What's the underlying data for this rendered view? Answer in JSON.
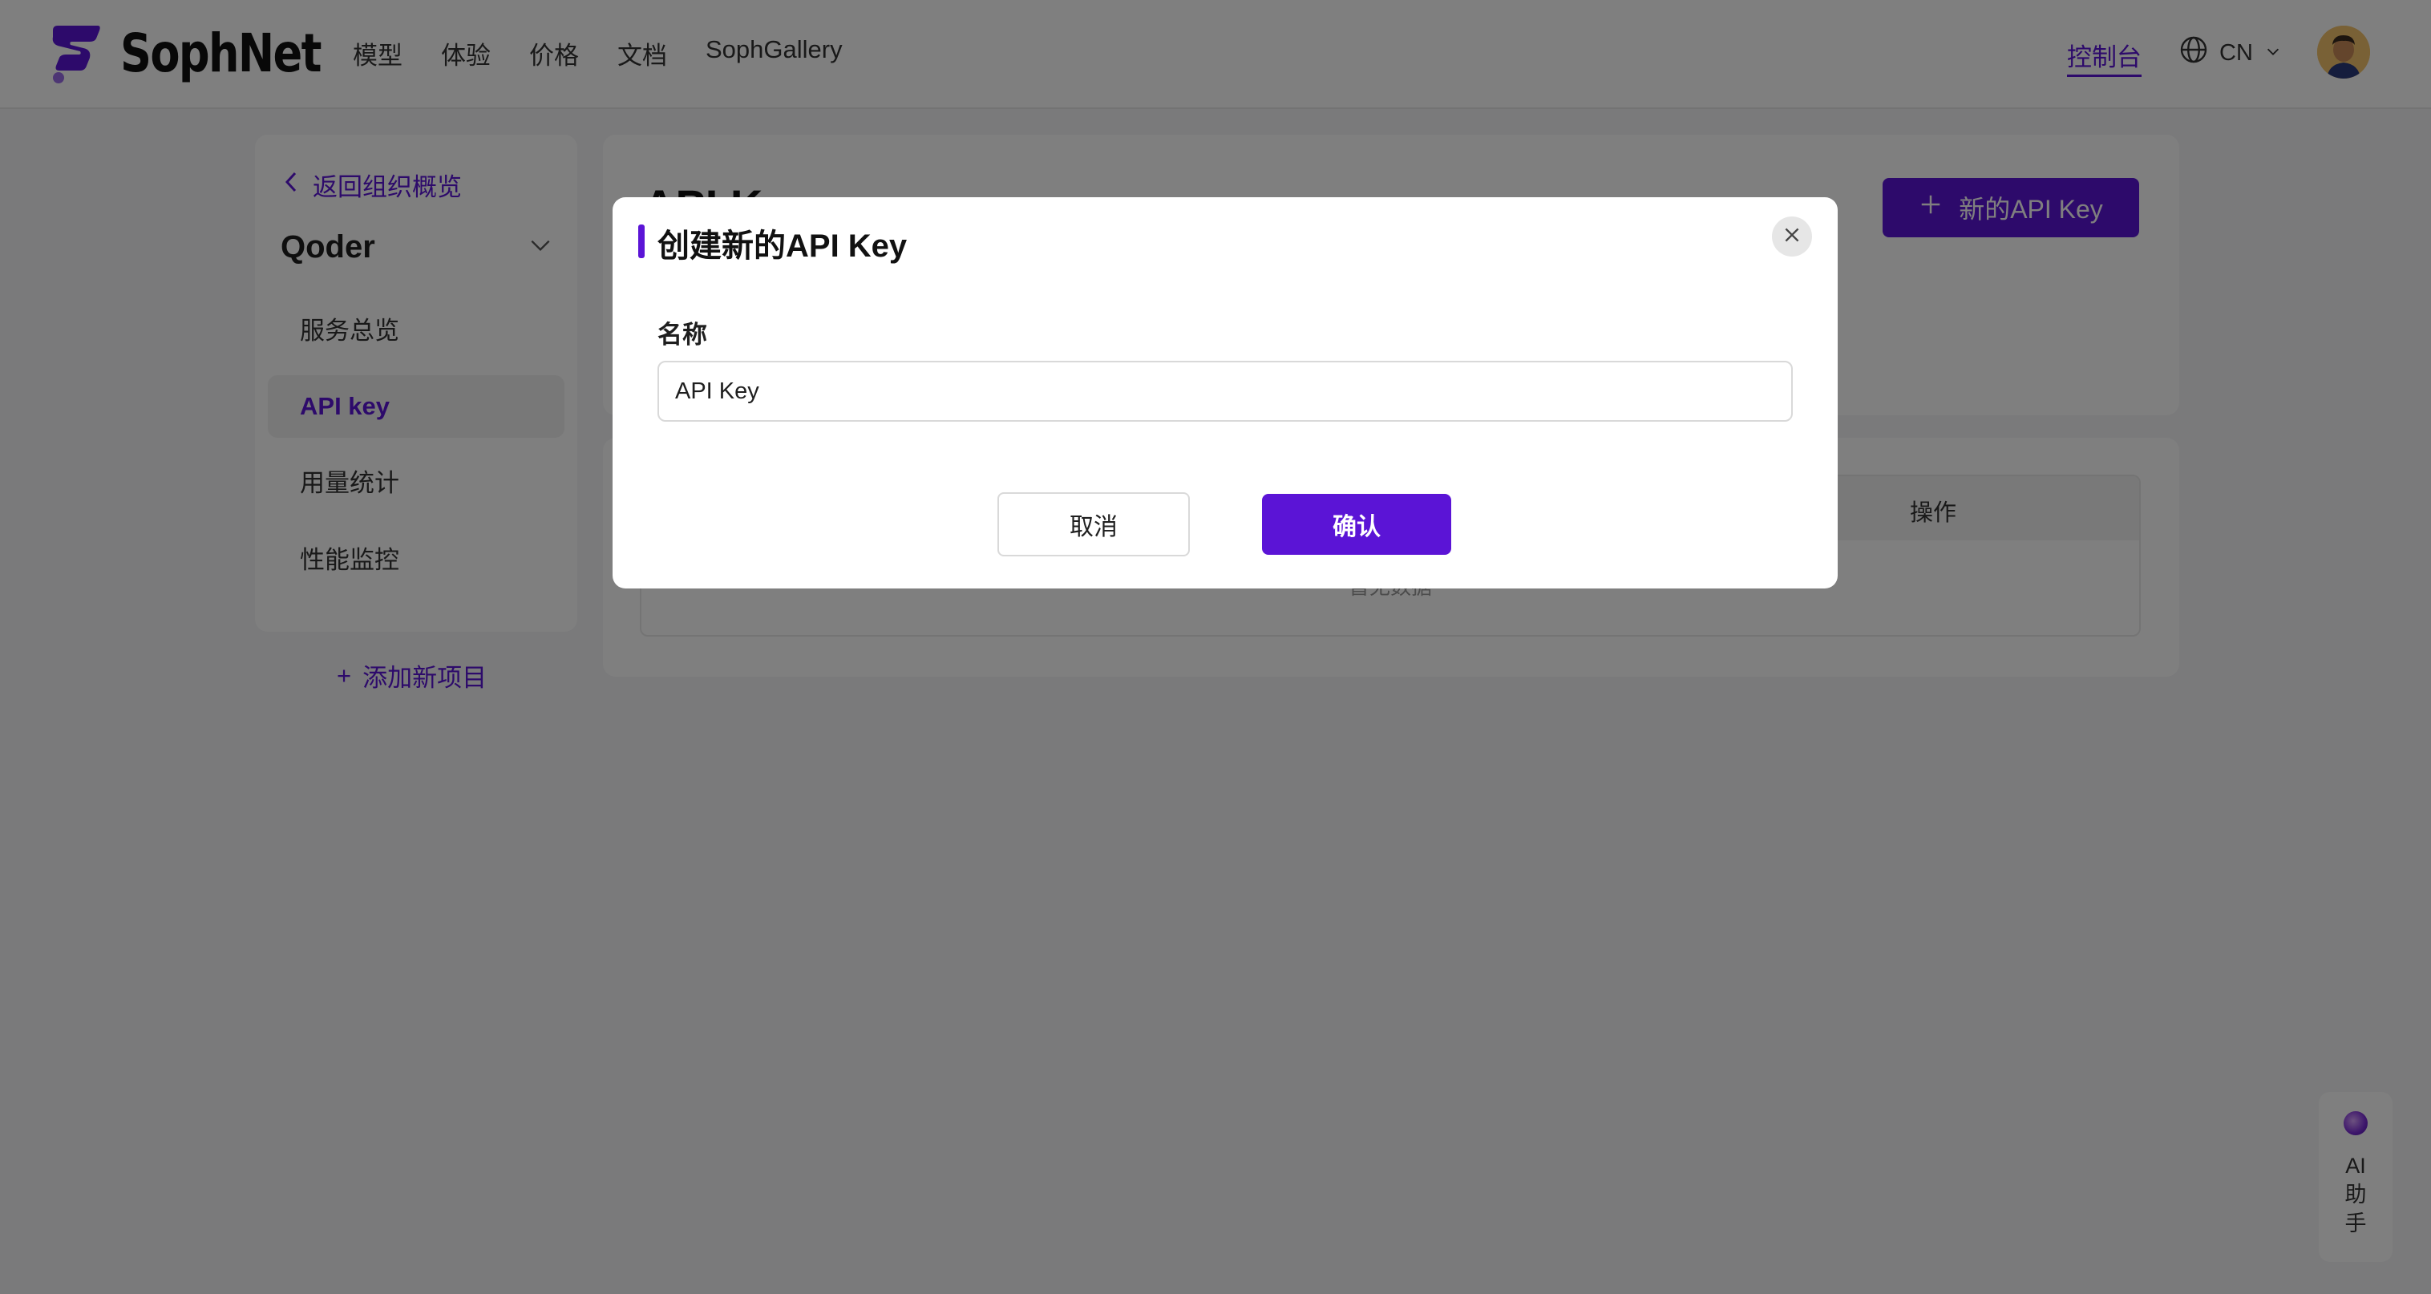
{
  "header": {
    "brand": "SophNet",
    "nav": [
      "模型",
      "体验",
      "价格",
      "文档",
      "SophGallery"
    ],
    "console": "控制台",
    "language": "CN"
  },
  "sidebar": {
    "back": "返回组织概览",
    "org_name": "Qoder",
    "items": [
      {
        "label": "服务总览"
      },
      {
        "label": "API key"
      },
      {
        "label": "用量统计"
      },
      {
        "label": "性能监控"
      }
    ],
    "add_project": "添加新项目"
  },
  "main": {
    "title": "API Key",
    "new_key_button": "新的API Key",
    "table": {
      "ops_header": "操作",
      "empty": "暂无数据"
    }
  },
  "modal": {
    "title": "创建新的API Key",
    "name_label": "名称",
    "name_value": "API Key",
    "cancel": "取消",
    "confirm": "确认"
  },
  "ai_helper": {
    "label": "AI助手"
  },
  "colors": {
    "accent": "#5b14d6"
  }
}
